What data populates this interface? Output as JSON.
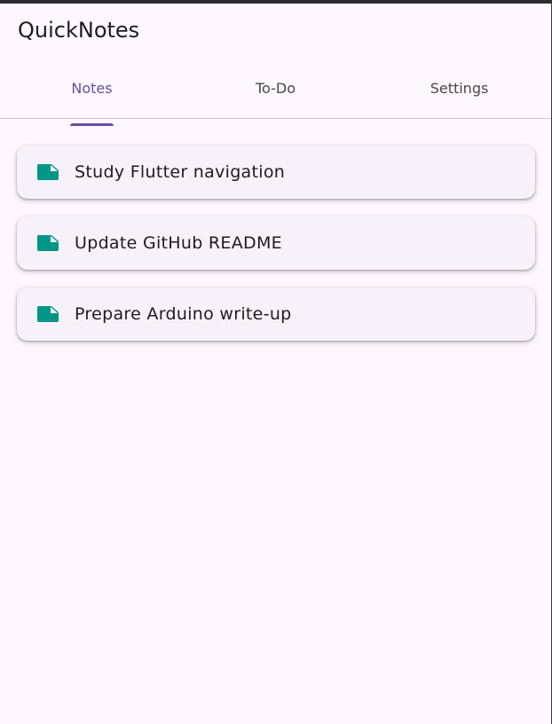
{
  "app": {
    "title": "QuickNotes"
  },
  "tabs": [
    {
      "label": "Notes",
      "active": true
    },
    {
      "label": "To-Do",
      "active": false
    },
    {
      "label": "Settings",
      "active": false
    }
  ],
  "notes": [
    {
      "title": "Study Flutter navigation",
      "icon": "note-icon"
    },
    {
      "title": "Update GitHub README",
      "icon": "note-icon"
    },
    {
      "title": "Prepare Arduino write-up",
      "icon": "note-icon"
    }
  ],
  "colors": {
    "background": "#fef7ff",
    "primary": "#6750a4",
    "note_icon": "#009688",
    "card": "#f7f2fa"
  }
}
